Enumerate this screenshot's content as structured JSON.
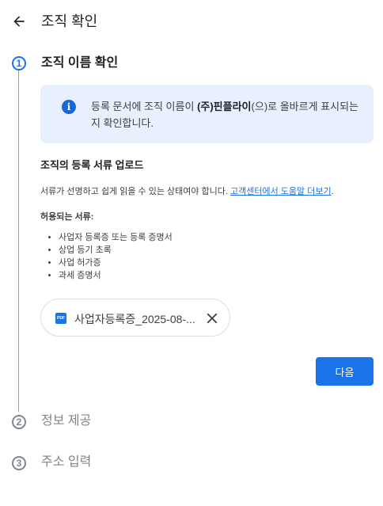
{
  "header": {
    "title": "조직 확인",
    "back_icon": "arrow-back-icon"
  },
  "steps": [
    {
      "number": "1",
      "title": "조직 이름 확인",
      "state": "active"
    },
    {
      "number": "2",
      "title": "정보 제공",
      "state": "inactive"
    },
    {
      "number": "3",
      "title": "주소 입력",
      "state": "inactive"
    }
  ],
  "info": {
    "icon": "info-icon",
    "text_before": "등록 문서에 조직 이름이 ",
    "org_name": "(주)핀플라이",
    "text_after": "(으)로 올바르게 표시되는지 확인합니다."
  },
  "upload": {
    "heading": "조직의 등록 서류 업로드",
    "description": "서류가 선명하고 쉽게 읽을 수 있는 상태여야 합니다. ",
    "help_link": "고객센터에서 도움말 더보기",
    "description_end": ".",
    "allowed_title": "허용되는 서류:",
    "allowed_docs": [
      "사업자 등록증 또는 등록 증명서",
      "상업 등기 초록",
      "사업 허가증",
      "과세 증명서"
    ],
    "file": {
      "type_label": "PDF",
      "name": "사업자등록증_2025-08-..."
    }
  },
  "actions": {
    "next_label": "다음"
  },
  "colors": {
    "accent": "#1a73e8",
    "info_bg": "#e8f0fe",
    "inactive": "#80868b"
  }
}
